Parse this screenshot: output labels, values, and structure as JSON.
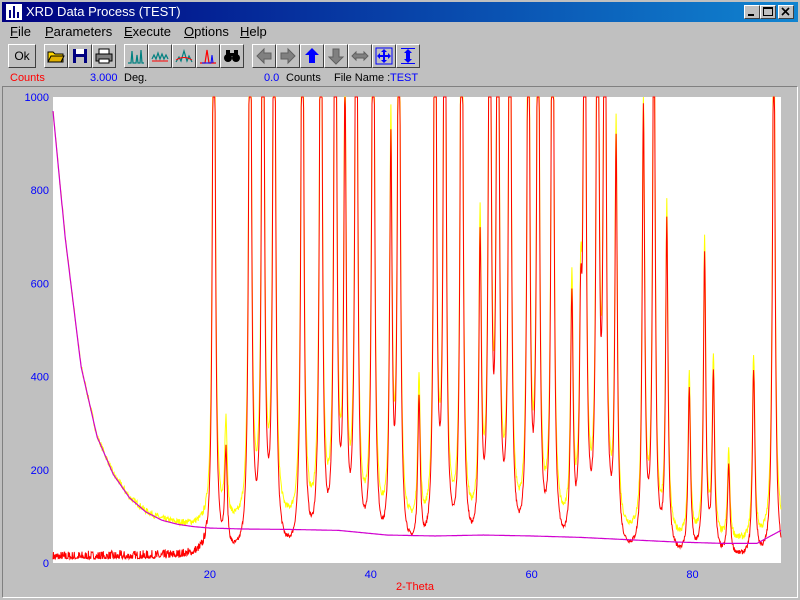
{
  "window": {
    "title": "XRD Data Process (TEST)"
  },
  "menu": [
    {
      "key": "F",
      "rest": "ile"
    },
    {
      "key": "P",
      "rest": "arameters"
    },
    {
      "key": "E",
      "rest": "xecute"
    },
    {
      "key": "O",
      "rest": "ptions"
    },
    {
      "key": "H",
      "rest": "elp"
    }
  ],
  "toolbar": {
    "ok_label": "Ok"
  },
  "status": {
    "counts_label": "Counts",
    "deg_value": "3.000",
    "deg_unit": "Deg.",
    "counts_value": "0.0",
    "counts_unit": "Counts",
    "file_label": "File Name :",
    "file_value": "TEST"
  },
  "colors": {
    "observed": "#ffff00",
    "processed": "#ff0000",
    "background": "#d000d0",
    "axis_labels": "#0000ff",
    "xlabel": "#ff0000"
  },
  "chart_data": {
    "type": "line",
    "xlabel": "2-Theta",
    "ylabel": "",
    "xlim": [
      0.5,
      91
    ],
    "ylim": [
      0,
      1000
    ],
    "x_ticks": [
      20,
      40,
      60,
      80
    ],
    "y_ticks": [
      0,
      200,
      400,
      600,
      800,
      1000
    ],
    "series": [
      {
        "color": "yellow",
        "values_desc": "raw intensity"
      },
      {
        "color": "red",
        "values_desc": "background-subtracted intensity"
      },
      {
        "color": "magenta",
        "values_desc": "background"
      }
    ],
    "peaks": [
      {
        "x": 20.5,
        "y": 1000
      },
      {
        "x": 22.0,
        "y": 130
      },
      {
        "x": 25.0,
        "y": 1000
      },
      {
        "x": 26.6,
        "y": 1000
      },
      {
        "x": 28.0,
        "y": 1000
      },
      {
        "x": 31.5,
        "y": 1000
      },
      {
        "x": 33.8,
        "y": 1000
      },
      {
        "x": 35.6,
        "y": 1000
      },
      {
        "x": 36.8,
        "y": 600
      },
      {
        "x": 38.2,
        "y": 1000
      },
      {
        "x": 40.3,
        "y": 1000
      },
      {
        "x": 42.5,
        "y": 530
      },
      {
        "x": 43.5,
        "y": 950
      },
      {
        "x": 46.0,
        "y": 200
      },
      {
        "x": 48.0,
        "y": 1000
      },
      {
        "x": 49.2,
        "y": 1000
      },
      {
        "x": 51.3,
        "y": 1000
      },
      {
        "x": 53.6,
        "y": 400
      },
      {
        "x": 54.8,
        "y": 1000
      },
      {
        "x": 55.8,
        "y": 1000
      },
      {
        "x": 57.3,
        "y": 1000
      },
      {
        "x": 59.6,
        "y": 930
      },
      {
        "x": 60.8,
        "y": 950
      },
      {
        "x": 62.6,
        "y": 1000
      },
      {
        "x": 65.0,
        "y": 330
      },
      {
        "x": 66.1,
        "y": 250
      },
      {
        "x": 66.6,
        "y": 1000
      },
      {
        "x": 68.2,
        "y": 1000
      },
      {
        "x": 69.1,
        "y": 1000
      },
      {
        "x": 70.5,
        "y": 540
      },
      {
        "x": 73.9,
        "y": 590
      },
      {
        "x": 75.2,
        "y": 800
      },
      {
        "x": 76.8,
        "y": 440
      },
      {
        "x": 79.6,
        "y": 220
      },
      {
        "x": 81.5,
        "y": 400
      },
      {
        "x": 82.6,
        "y": 240
      },
      {
        "x": 84.5,
        "y": 120
      },
      {
        "x": 87.6,
        "y": 250
      },
      {
        "x": 90.1,
        "y": 780
      }
    ],
    "background_curve": [
      {
        "x": 0.5,
        "y": 970
      },
      {
        "x": 2,
        "y": 700
      },
      {
        "x": 4,
        "y": 420
      },
      {
        "x": 6,
        "y": 270
      },
      {
        "x": 8,
        "y": 190
      },
      {
        "x": 10,
        "y": 140
      },
      {
        "x": 12,
        "y": 110
      },
      {
        "x": 14,
        "y": 92
      },
      {
        "x": 16,
        "y": 83
      },
      {
        "x": 18,
        "y": 78
      },
      {
        "x": 20,
        "y": 75
      },
      {
        "x": 24,
        "y": 73
      },
      {
        "x": 30,
        "y": 72
      },
      {
        "x": 36,
        "y": 70
      },
      {
        "x": 42,
        "y": 60
      },
      {
        "x": 48,
        "y": 58
      },
      {
        "x": 54,
        "y": 60
      },
      {
        "x": 60,
        "y": 58
      },
      {
        "x": 66,
        "y": 55
      },
      {
        "x": 72,
        "y": 50
      },
      {
        "x": 78,
        "y": 45
      },
      {
        "x": 84,
        "y": 42
      },
      {
        "x": 88,
        "y": 42
      },
      {
        "x": 91,
        "y": 70
      }
    ]
  }
}
